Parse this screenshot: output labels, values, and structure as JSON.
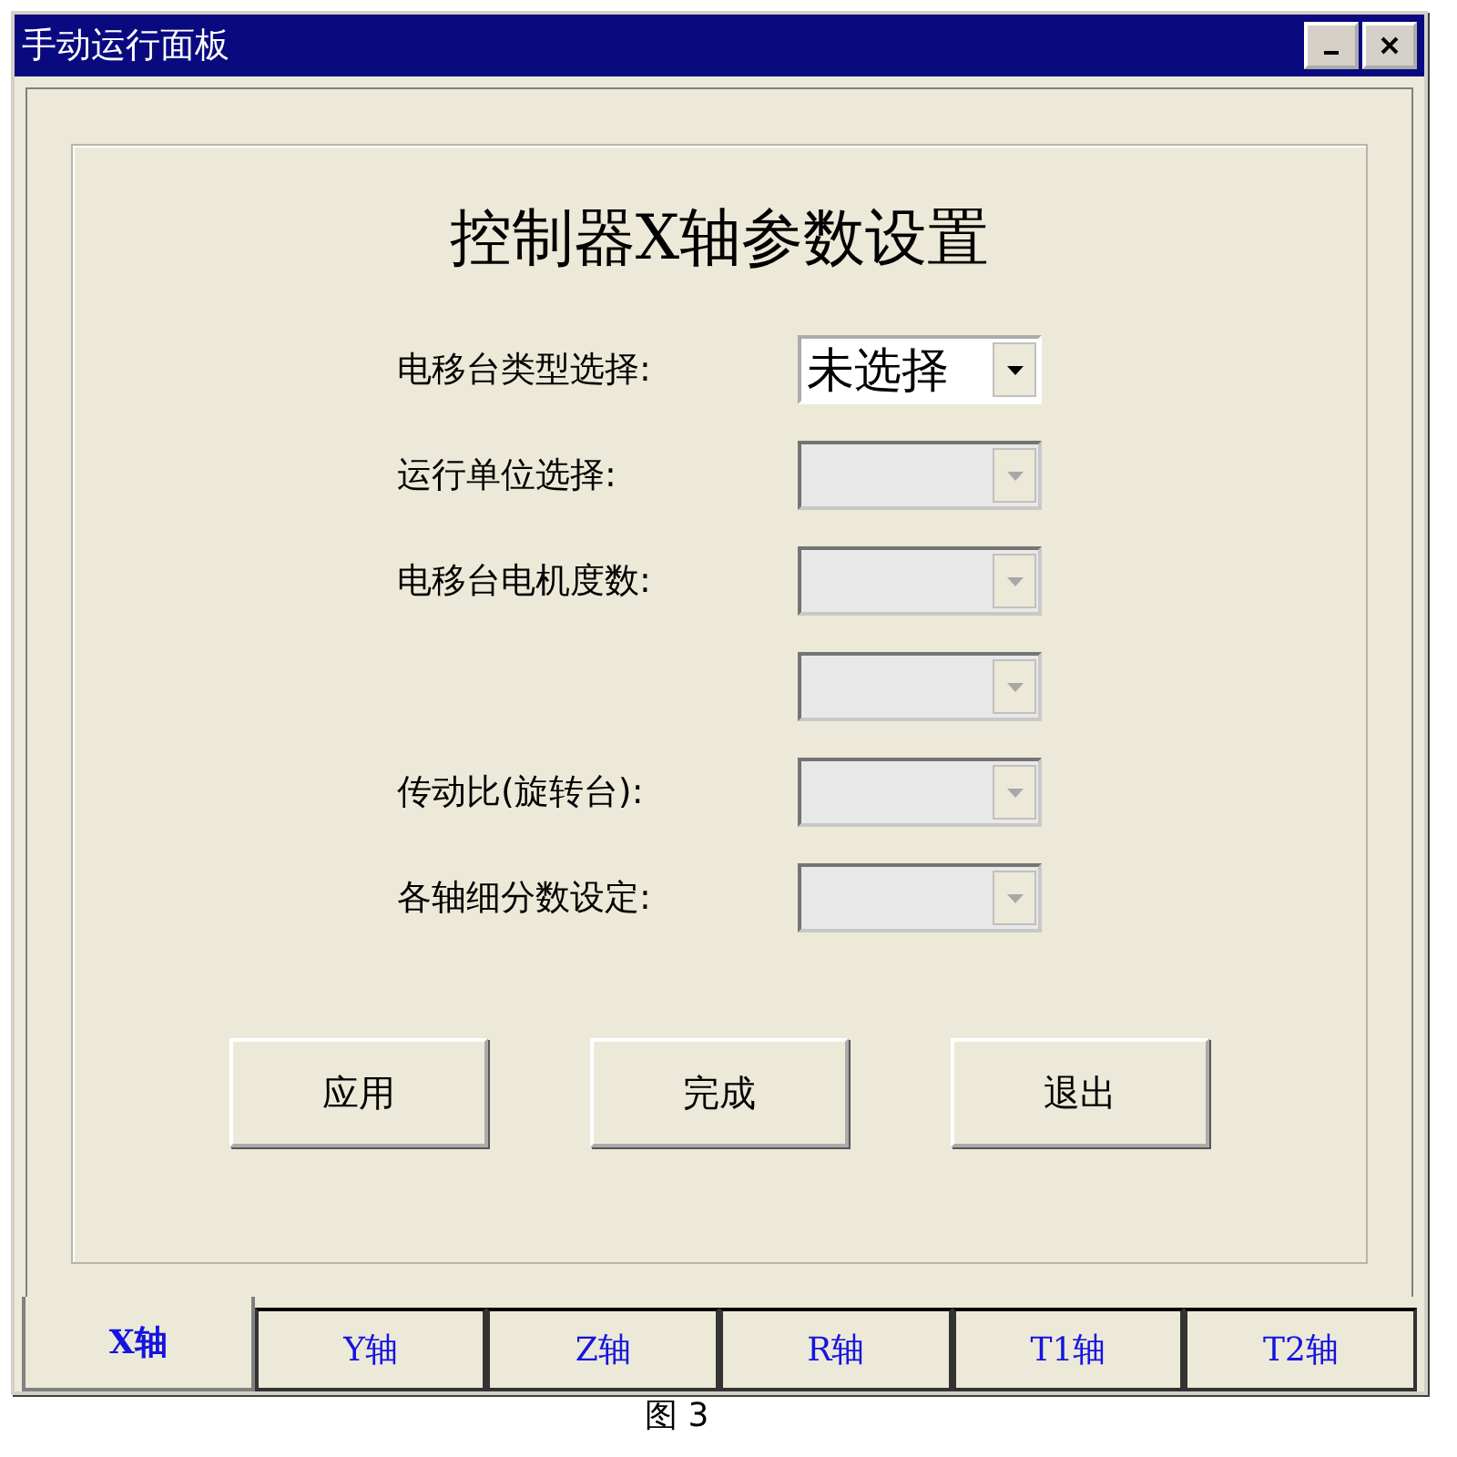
{
  "window": {
    "title": "手动运行面板"
  },
  "heading": "控制器X轴参数设置",
  "fields": [
    {
      "label": "电移台类型选择:",
      "value": "未选择",
      "disabled": false
    },
    {
      "label": "运行单位选择:",
      "disabled": true
    },
    {
      "label": "电移台电机度数:",
      "disabled": true
    },
    {
      "disabled": true
    },
    {
      "label": "传动比(旋转台):",
      "disabled": true
    },
    {
      "label": "各轴细分数设定:",
      "disabled": true
    }
  ],
  "buttons": [
    "应用",
    "完成",
    "退出"
  ],
  "tabs": [
    {
      "label": "X轴",
      "selected": true
    },
    {
      "label": "Y轴",
      "selected": false
    },
    {
      "label": "Z轴",
      "selected": false
    },
    {
      "label": "R轴",
      "selected": false
    },
    {
      "label": "T1轴",
      "selected": false
    },
    {
      "label": "T2轴",
      "selected": false
    }
  ],
  "caption": "图 3"
}
